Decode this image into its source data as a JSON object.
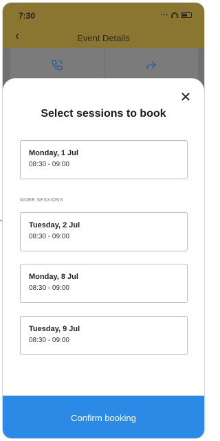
{
  "status_bar": {
    "time": "7:30",
    "signal_dots": "•••"
  },
  "nav": {
    "back_glyph": "‹",
    "title": "Event Details"
  },
  "background_actions": [
    {
      "icon": "phone-icon"
    },
    {
      "icon": "share-icon"
    }
  ],
  "sheet": {
    "close_glyph": "✕",
    "title": "Select sessions to book",
    "first_session": {
      "day": "Monday, 1 Jul",
      "time": "08:30 - 09:00"
    },
    "more_label": "MORE SESSIONS",
    "sessions": [
      {
        "day": "Tuesday, 2 Jul",
        "time": "08:30 - 09:00"
      },
      {
        "day": "Monday, 8 Jul",
        "time": "08:30 - 09:00"
      },
      {
        "day": "Tuesday, 9 Jul",
        "time": "08:30 - 09:00"
      }
    ],
    "confirm_label": "Confirm booking"
  },
  "colors": {
    "accent": "#2a8ae5",
    "header_dim": "#8a7630",
    "overlay": "#707070"
  }
}
